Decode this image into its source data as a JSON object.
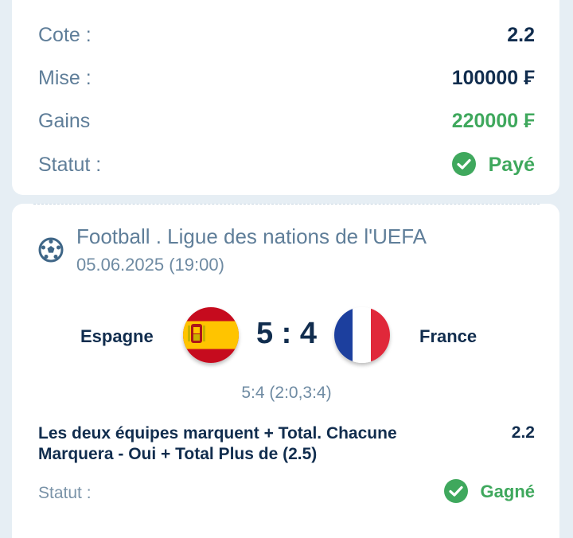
{
  "summary": {
    "odds_label": "Cote :",
    "odds_value": "2.2",
    "stake_label": "Mise :",
    "stake_value": "100000 ₣",
    "winnings_label": "Gains",
    "winnings_value": "220000 ₣",
    "status_label": "Statut :",
    "status_value": "Payé"
  },
  "event": {
    "sport_icon": "soccer-ball-icon",
    "league": "Football . Ligue des nations de l'UEFA",
    "datetime": "05.06.2025 (19:00)",
    "home_team": "Espagne",
    "away_team": "France",
    "score": "5 : 4",
    "detailed_score": "5:4 (2:0,3:4)",
    "market": "Les deux équipes marquent + Total. Chacune Marquera - Oui + Total Plus de (2.5)",
    "market_odd": "2.2",
    "status_label": "Statut :",
    "status_value": "Gagné"
  },
  "colors": {
    "background": "#e6eef4",
    "primary_text": "#112d4e",
    "muted_text": "#5f7e99",
    "success": "#3fa85d"
  }
}
